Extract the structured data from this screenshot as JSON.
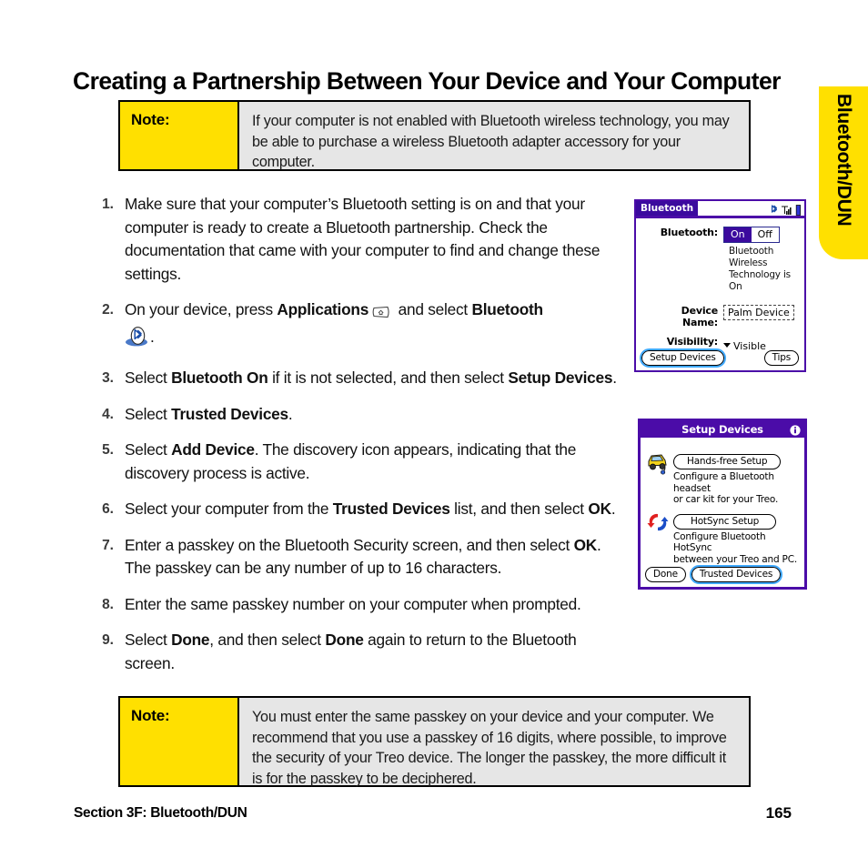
{
  "side_tab": {
    "label": "Bluetooth/DUN"
  },
  "page_title": "Creating a Partnership Between Your Device and Your Computer",
  "note_top": {
    "label": "Note:",
    "body": "If your computer is not enabled with Bluetooth wireless technology, you may be able to purchase a wireless Bluetooth adapter accessory for your computer."
  },
  "note_bottom": {
    "label": "Note:",
    "body": "You must enter the same passkey on your device and your computer. We recommend that you use a passkey of 16 digits, where possible, to improve the security of your Treo device. The longer the passkey, the more difficult it is for the passkey to be deciphered."
  },
  "steps": [
    {
      "num": "1.",
      "text": "Make sure that your computer’s Bluetooth setting is on and that your computer is ready to create a Bluetooth partnership. Check the documentation that came with your computer to find and change these settings."
    },
    {
      "num": "2.",
      "seg_a": "On your device, press ",
      "bold_a": "Applications",
      "icon_a": "applications-hardkey-icon",
      "seg_b": " and select ",
      "bold_b": "Bluetooth",
      "icon_b": "bluetooth-app-icon",
      "seg_c": "."
    },
    {
      "num": "3.",
      "seg_a": "Select ",
      "bold_a": "Bluetooth On",
      "seg_b": " if it is not selected, and then select ",
      "bold_b": "Setup Devices",
      "seg_c": "."
    },
    {
      "num": "4.",
      "seg_a": "Select ",
      "bold_a": "Trusted Devices",
      "seg_b": "."
    },
    {
      "num": "5.",
      "seg_a": "Select ",
      "bold_a": "Add Device",
      "seg_b": ". The discovery icon appears, indicating that the discovery process is active."
    },
    {
      "num": "6.",
      "seg_a": "Select your computer from the ",
      "bold_a": "Trusted Devices",
      "seg_b": " list, and then select ",
      "bold_b": "OK",
      "seg_c": "."
    },
    {
      "num": "7.",
      "seg_a": "Enter a passkey on the Bluetooth Security screen, and then select ",
      "bold_a": "OK",
      "seg_b": ". The passkey can be any number of up to 16 characters."
    },
    {
      "num": "8.",
      "text": "Enter the same passkey number on your computer when prompted."
    },
    {
      "num": "9.",
      "seg_a": "Select ",
      "bold_a": "Done",
      "seg_b": ", and then select ",
      "bold_b": "Done",
      "seg_c": " again to return to the Bluetooth screen."
    }
  ],
  "bluetooth_screen": {
    "title": "Bluetooth",
    "status_icons": [
      "bluetooth-icon",
      "signal-bars-icon",
      "battery-icon"
    ],
    "field_bluetooth_label": "Bluetooth:",
    "toggle_on": "On",
    "toggle_off": "Off",
    "toggle_selected": "On",
    "status_line1": "Bluetooth Wireless",
    "status_line2": "Technology is On",
    "field_device_name_label": "Device Name:",
    "device_name_value": "Palm Device",
    "field_visibility_label": "Visibility:",
    "visibility_value": "Visible",
    "button_setup_devices": "Setup Devices",
    "button_tips": "Tips"
  },
  "setup_devices_screen": {
    "title": "Setup Devices",
    "info_icon": "info-icon",
    "items": [
      {
        "icon": "car-headset-icon",
        "button": "Hands-free Setup",
        "desc_line1": "Configure a Bluetooth headset",
        "desc_line2": "or car kit for your Treo."
      },
      {
        "icon": "hotsync-icon",
        "button": "HotSync Setup",
        "desc_line1": "Configure Bluetooth HotSync",
        "desc_line2": "between your Treo and PC."
      }
    ],
    "button_done": "Done",
    "button_trusted_devices": "Trusted Devices"
  },
  "footer": {
    "section": "Section 3F: Bluetooth/DUN",
    "page_number": "165"
  },
  "colors": {
    "accent_yellow": "#FFE000",
    "note_body_gray": "#E6E6E6",
    "palm_purple": "#4B0CA8",
    "focus_blue": "#3FA9FF"
  }
}
